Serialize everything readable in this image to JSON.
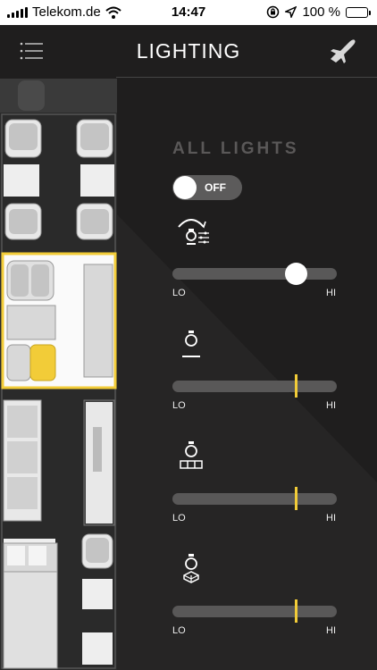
{
  "status_bar": {
    "carrier": "Telekom.de",
    "time": "14:47",
    "battery": "100 %"
  },
  "header": {
    "title": "LIGHTING"
  },
  "all_lights": {
    "label": "ALL LIGHTS",
    "toggle_label": "OFF",
    "enabled": false
  },
  "zones": [
    {
      "icon": "dimmer-bulb-icon",
      "level": 0.75,
      "thumb": "circle",
      "lo_label": "LO",
      "hi_label": "HI"
    },
    {
      "icon": "ceiling-bulb-icon",
      "level": 0.75,
      "thumb": "bar",
      "lo_label": "LO",
      "hi_label": "HI"
    },
    {
      "icon": "table-bulb-icon",
      "level": 0.75,
      "thumb": "bar",
      "lo_label": "LO",
      "hi_label": "HI"
    },
    {
      "icon": "floor-bulb-icon",
      "level": 0.75,
      "thumb": "bar",
      "lo_label": "LO",
      "hi_label": "HI"
    }
  ],
  "colors": {
    "accent": "#f2cc38",
    "background": "#1f1e1e",
    "track": "#595858"
  }
}
